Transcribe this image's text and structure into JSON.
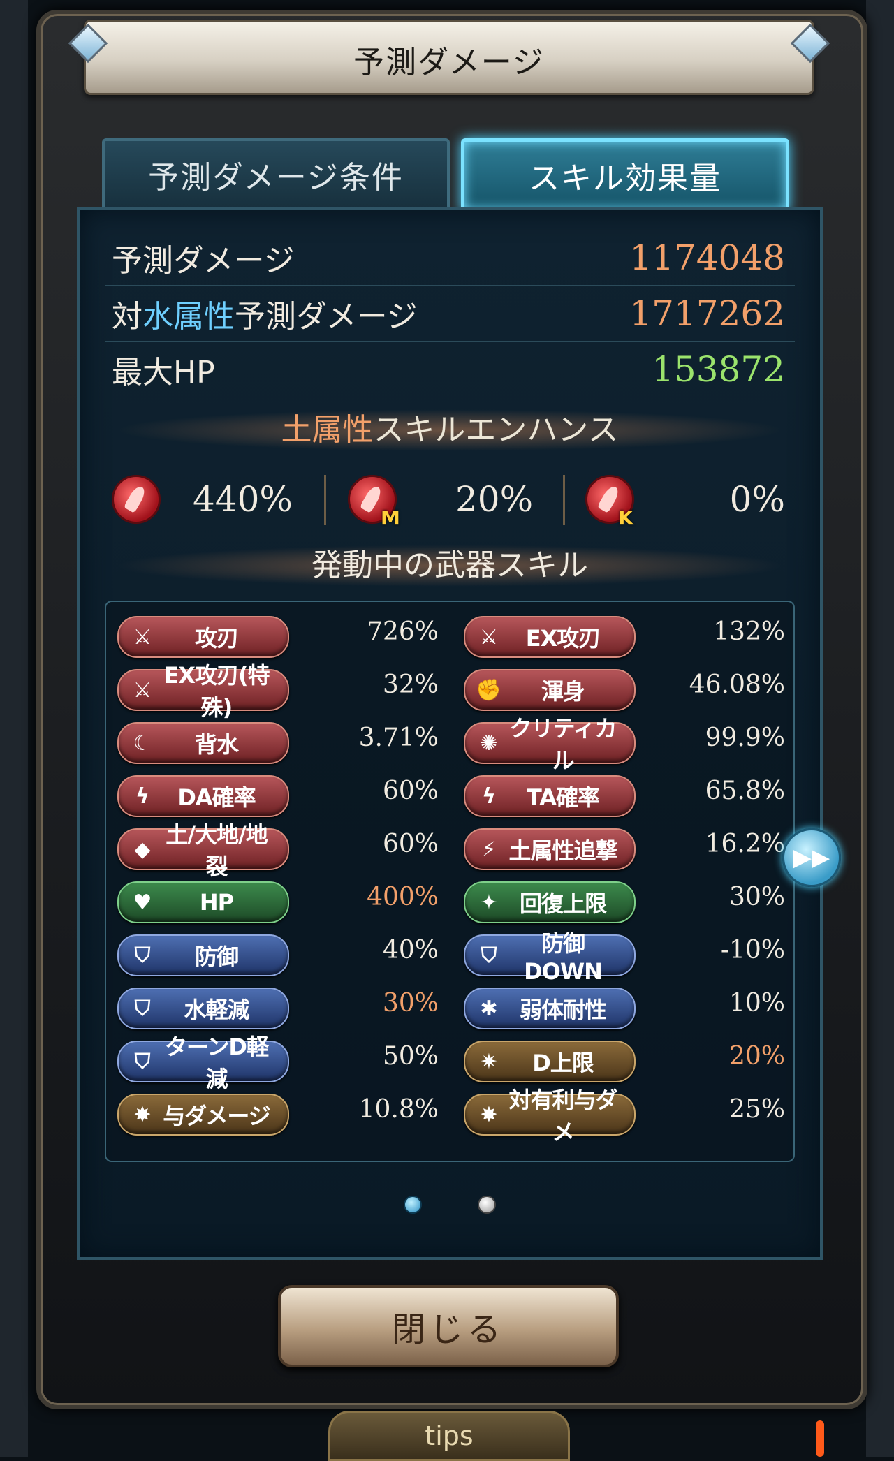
{
  "header": {
    "title": "予測ダメージ"
  },
  "tabs": [
    {
      "label": "予測ダメージ条件",
      "active": false
    },
    {
      "label": "スキル効果量",
      "active": true
    }
  ],
  "stats": {
    "predicted_damage": {
      "label": "予測ダメージ",
      "value": "1174048"
    },
    "vs_water": {
      "label_prefix": "対",
      "label_element": "水属性",
      "label_suffix": "予測ダメージ",
      "value": "1717262"
    },
    "max_hp": {
      "label": "最大HP",
      "value": "153872"
    }
  },
  "enhance": {
    "title_element": "土属性",
    "title_suffix": "スキルエンハンス",
    "items": [
      {
        "icon": "earth-skill-icon",
        "badge": "",
        "value": "440%"
      },
      {
        "icon": "earth-skill-magna-icon",
        "badge": "M",
        "value": "20%"
      },
      {
        "icon": "earth-skill-kaijin-icon",
        "badge": "K",
        "value": "0%"
      }
    ]
  },
  "weapon_skills": {
    "title": "発動中の武器スキル",
    "left": [
      {
        "label": "攻刃",
        "value": "726%",
        "icon": "sword-icon",
        "color": "red",
        "highlight": false
      },
      {
        "label": "EX攻刃(特殊)",
        "value": "32%",
        "icon": "sword-icon",
        "color": "red",
        "highlight": false
      },
      {
        "label": "背水",
        "value": "3.71%",
        "icon": "crescent-icon",
        "color": "red",
        "highlight": false
      },
      {
        "label": "DA確率",
        "value": "60%",
        "icon": "double-strike-icon",
        "color": "red",
        "highlight": false
      },
      {
        "label": "土/大地/地裂",
        "value": "60%",
        "icon": "earth-drop-icon",
        "color": "red",
        "highlight": false
      },
      {
        "label": "HP",
        "value": "400%",
        "icon": "heart-icon",
        "color": "green",
        "highlight": true
      },
      {
        "label": "防御",
        "value": "40%",
        "icon": "shield-icon",
        "color": "blue",
        "highlight": false
      },
      {
        "label": "水軽減",
        "value": "30%",
        "icon": "shield-icon",
        "color": "blue",
        "highlight": true
      },
      {
        "label": "ターンD軽減",
        "value": "50%",
        "icon": "shield-icon",
        "color": "blue",
        "highlight": false
      },
      {
        "label": "与ダメージ",
        "value": "10.8%",
        "icon": "burst-icon",
        "color": "gold",
        "highlight": false
      }
    ],
    "right": [
      {
        "label": "EX攻刃",
        "value": "132%",
        "icon": "sword-icon",
        "color": "red",
        "highlight": false
      },
      {
        "label": "渾身",
        "value": "46.08%",
        "icon": "arm-icon",
        "color": "red",
        "highlight": false
      },
      {
        "label": "クリティカル",
        "value": "99.9%",
        "icon": "critical-icon",
        "color": "red",
        "highlight": false
      },
      {
        "label": "TA確率",
        "value": "65.8%",
        "icon": "triple-strike-icon",
        "color": "red",
        "highlight": false
      },
      {
        "label": "土属性追撃",
        "value": "16.2%",
        "icon": "lightning-icon",
        "color": "red",
        "highlight": false
      },
      {
        "label": "回復上限",
        "value": "30%",
        "icon": "sparkle-icon",
        "color": "green",
        "highlight": false
      },
      {
        "label": "防御DOWN",
        "value": "-10%",
        "icon": "broken-shield-icon",
        "color": "blue",
        "highlight": false
      },
      {
        "label": "弱体耐性",
        "value": "10%",
        "icon": "resist-icon",
        "color": "blue",
        "highlight": false
      },
      {
        "label": "D上限",
        "value": "20%",
        "icon": "cap-burst-icon",
        "color": "gold",
        "highlight": true
      },
      {
        "label": "対有利与ダメ",
        "value": "25%",
        "icon": "burst-icon",
        "color": "gold",
        "highlight": false
      }
    ]
  },
  "pagination": {
    "total": 2,
    "current": 1
  },
  "buttons": {
    "close": "閉じる",
    "tips": "tips"
  },
  "colors": {
    "damage": "#f2a06a",
    "hp": "#9be36c",
    "water": "#6fd0ff",
    "highlight": "#f2a06a"
  }
}
